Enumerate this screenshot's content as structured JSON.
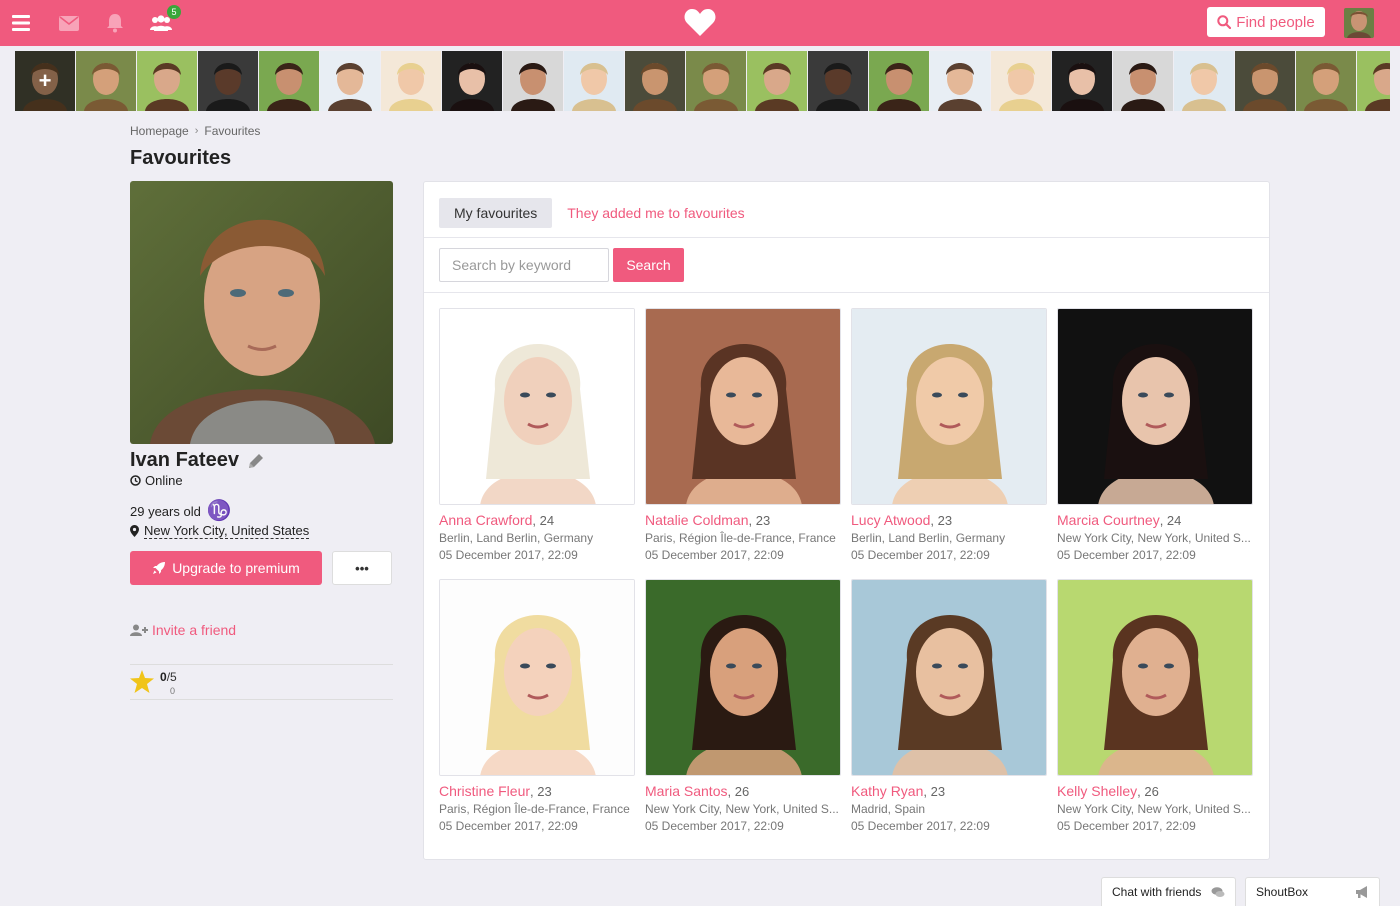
{
  "topbar": {
    "menu_icon": "hamburger-icon",
    "mail_icon": "envelope-icon",
    "notif_icon": "bell-icon",
    "friends_icon": "users-icon",
    "friends_badge": "5",
    "logo_icon": "heart-icon",
    "find_people_label": "Find people",
    "accent": "#f05a7e"
  },
  "strip": {
    "add_label": "+",
    "count": 23
  },
  "breadcrumb": {
    "home": "Homepage",
    "current": "Favourites"
  },
  "page_title": "Favourites",
  "profile": {
    "name": "Ivan Fateev",
    "status": "Online",
    "age": "29 years old",
    "zodiac": "♑",
    "location": "New York City, United States",
    "upgrade_label": "Upgrade to premium",
    "more_label": "•••",
    "invite_label": "Invite a friend",
    "rating_score": "0",
    "rating_max": "/5",
    "rating_count": "0"
  },
  "tabs": {
    "my_favourites": "My favourites",
    "they_added": "They added me to favourites"
  },
  "search": {
    "placeholder": "Search by keyword",
    "button": "Search"
  },
  "favourites": [
    {
      "name": "Anna Crawford",
      "age": ", 24",
      "location": "Berlin, Land Berlin, Germany",
      "date": "05 December 2017, 22:09"
    },
    {
      "name": "Natalie Coldman",
      "age": ", 23",
      "location": "Paris, Région Île-de-France, France",
      "date": "05 December 2017, 22:09"
    },
    {
      "name": "Lucy Atwood",
      "age": ", 23",
      "location": "Berlin, Land Berlin, Germany",
      "date": "05 December 2017, 22:09"
    },
    {
      "name": "Marcia Courtney",
      "age": ", 24",
      "location": "New York City, New York, United S...",
      "date": "05 December 2017, 22:09"
    },
    {
      "name": "Christine Fleur",
      "age": ", 23",
      "location": "Paris, Région Île-de-France, France",
      "date": "05 December 2017, 22:09"
    },
    {
      "name": "Maria Santos",
      "age": ", 26",
      "location": "New York City, New York, United S...",
      "date": "05 December 2017, 22:09"
    },
    {
      "name": "Kathy Ryan",
      "age": ", 23",
      "location": "Madrid, Spain",
      "date": "05 December 2017, 22:09"
    },
    {
      "name": "Kelly Shelley",
      "age": ", 26",
      "location": "New York City, New York, United S...",
      "date": "05 December 2017, 22:09"
    }
  ],
  "chat": {
    "friends_label": "Chat with friends",
    "shoutbox_label": "ShoutBox"
  }
}
